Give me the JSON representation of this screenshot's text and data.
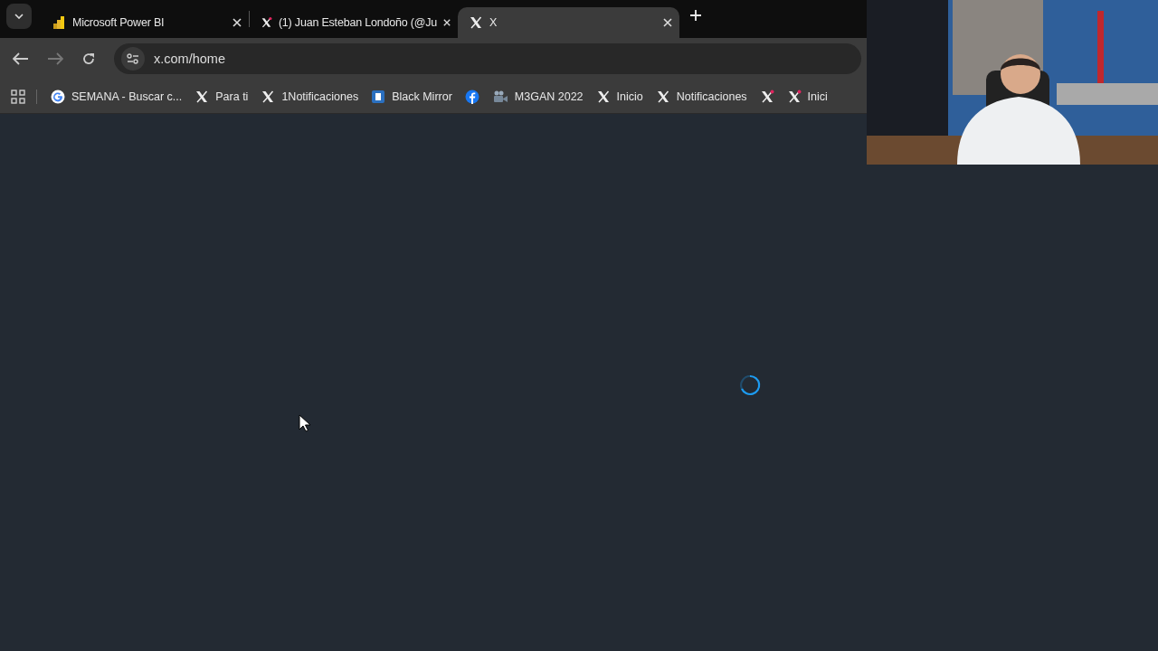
{
  "tabs": [
    {
      "title": "Microsoft Power BI",
      "kind": "powerbi",
      "selected": false
    },
    {
      "title": "(1) Juan Esteban Londoño (@Ju",
      "kind": "x-badge",
      "selected": false
    },
    {
      "title": "X",
      "kind": "x",
      "selected": true
    }
  ],
  "toolbar": {
    "back_disabled": false,
    "forward_disabled": true,
    "url": "x.com/home"
  },
  "bookmarks": [
    {
      "label": "SEMANA - Buscar c...",
      "kind": "google"
    },
    {
      "label": "Para ti",
      "kind": "x"
    },
    {
      "label": "1Notificaciones",
      "kind": "x"
    },
    {
      "label": "Black Mirror",
      "kind": "doc"
    },
    {
      "kind": "facebook"
    },
    {
      "label": "M3GAN 2022",
      "kind": "video"
    },
    {
      "label": "Inicio",
      "kind": "x"
    },
    {
      "label": "Notificaciones",
      "kind": "x"
    },
    {
      "kind": "x-badge"
    },
    {
      "label": "Inici",
      "kind": "x-badge"
    }
  ]
}
